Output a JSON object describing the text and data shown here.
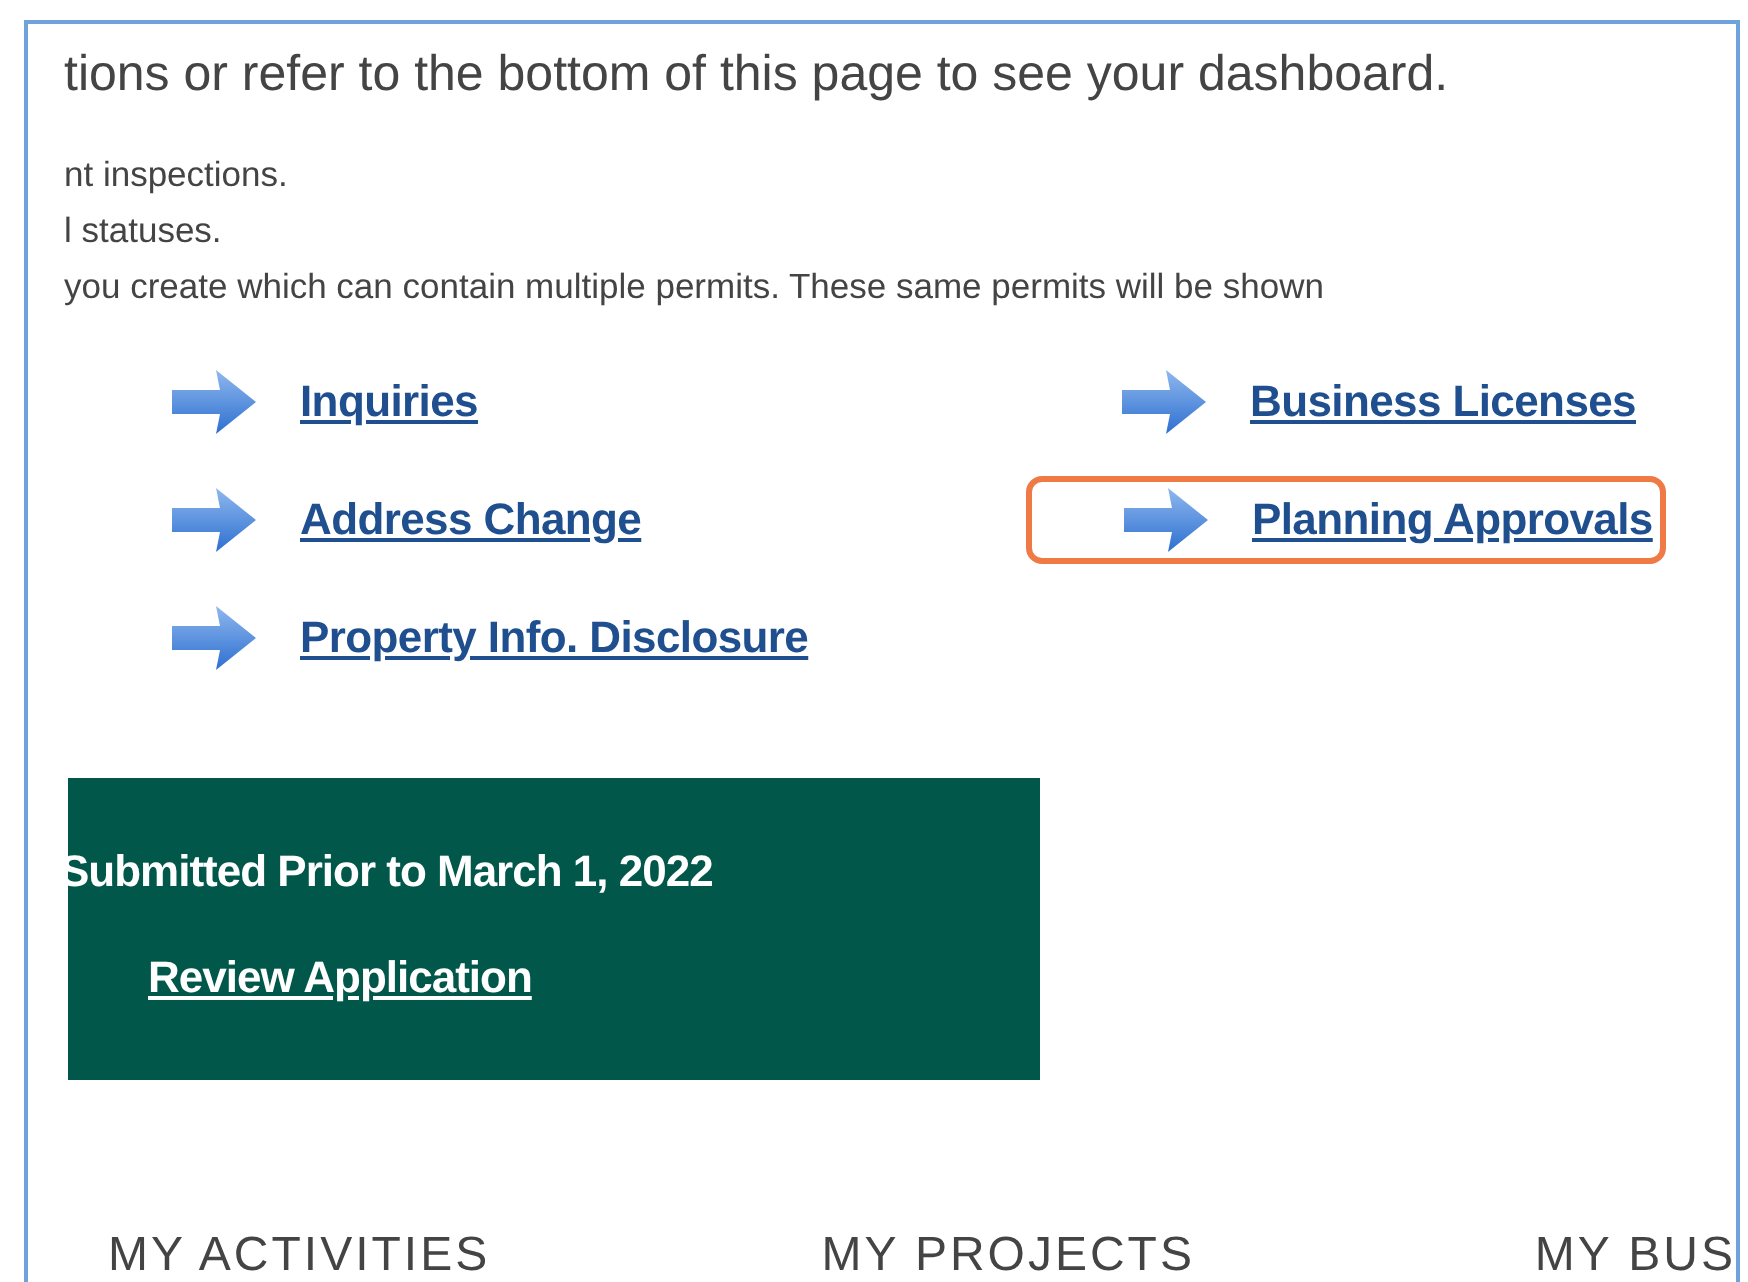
{
  "intro": "tions or refer to the bottom of this page to see your dashboard.",
  "notes": [
    "nt inspections.",
    "l statuses.",
    "you create which can contain multiple permits. These same permits will be shown"
  ],
  "links": [
    [
      {
        "label": "Inquiries",
        "highlighted": false
      },
      {
        "label": "Address Change",
        "highlighted": false
      },
      {
        "label": "Property Info. Disclosure",
        "highlighted": false
      }
    ],
    [
      {
        "label": "Business Licenses",
        "highlighted": false
      },
      {
        "label": "Planning Approvals",
        "highlighted": true
      }
    ]
  ],
  "banner": {
    "title": "Submitted Prior to March 1, 2022",
    "link": "Review Application"
  },
  "tabs": [
    "MY ACTIVITIES",
    "MY PROJECTS",
    "MY BUS"
  ]
}
